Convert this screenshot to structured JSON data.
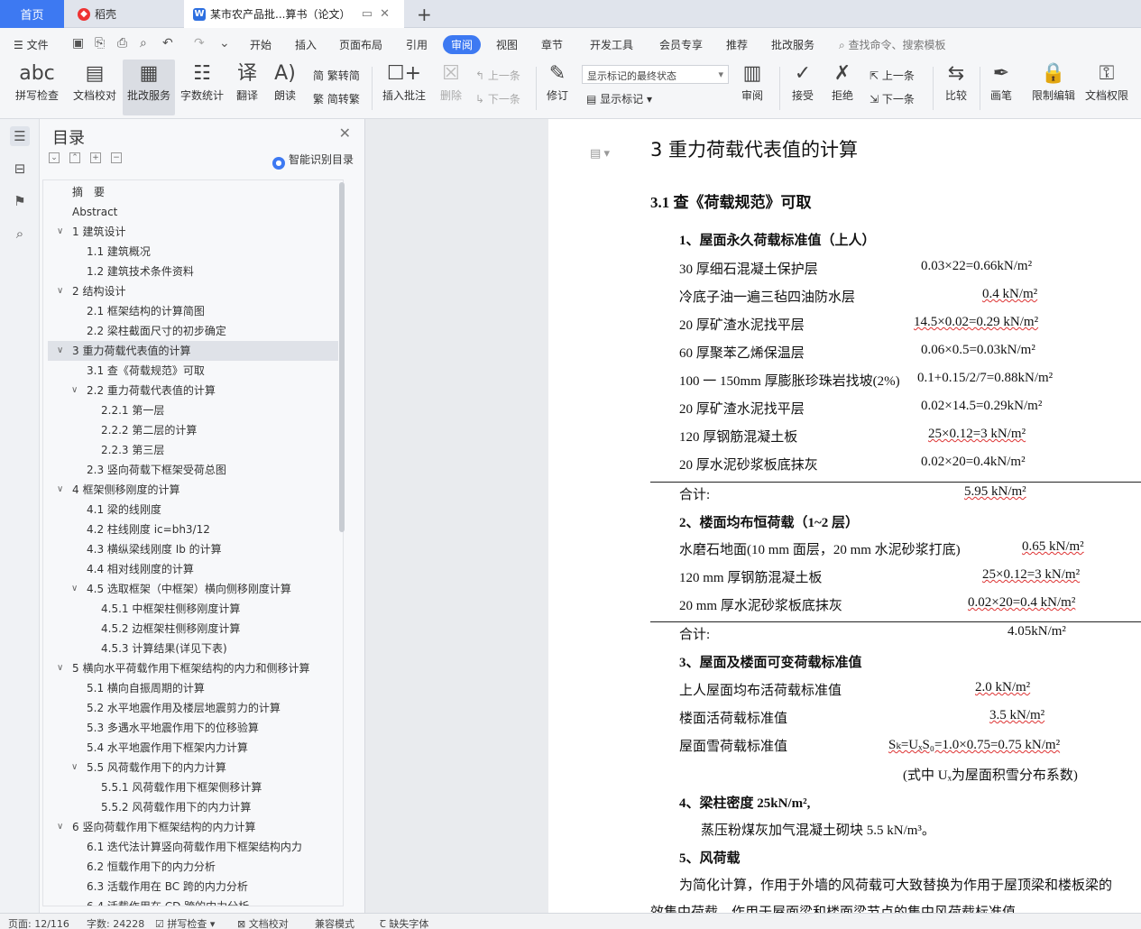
{
  "tabs": {
    "home": "首页",
    "daoke": "稻壳",
    "doc": "某市农产品批...算书（论文）"
  },
  "menu": {
    "file": "文件",
    "items": [
      "开始",
      "插入",
      "页面布局",
      "引用",
      "审阅",
      "视图",
      "章节",
      "开发工具",
      "会员专享",
      "推荐",
      "批改服务"
    ],
    "search": "查找命令、搜索模板"
  },
  "ribbon": {
    "spell": "拼写检查",
    "proof": "文档校对",
    "correct": "批改服务",
    "wordcount": "字数统计",
    "translate": "翻译",
    "read": "朗读",
    "trad": "繁转简",
    "simp": "简转繁",
    "insert_comment": "插入批注",
    "delete": "删除",
    "prev_comment": "上一条",
    "next_comment": "下一条",
    "revise": "修订",
    "markup_select": "显示标记的最终状态",
    "show_markup": "显示标记",
    "review_pane": "审阅",
    "accept": "接受",
    "reject": "拒绝",
    "prev": "上一条",
    "next": "下一条",
    "compare": "比较",
    "pen": "画笔",
    "restrict": "限制编辑",
    "permission": "文档权限"
  },
  "toc": {
    "title": "目录",
    "smart": "智能识别目录",
    "items": [
      {
        "text": "摘　要",
        "level": 0
      },
      {
        "text": "Abstract",
        "level": 0
      },
      {
        "text": "1  建筑设计",
        "level": 1
      },
      {
        "text": "1.1  建筑概况",
        "level": 2
      },
      {
        "text": "1.2  建筑技术条件资料",
        "level": 2
      },
      {
        "text": "2  结构设计",
        "level": 1
      },
      {
        "text": "2.1  框架结构的计算简图",
        "level": 2
      },
      {
        "text": "2.2  梁柱截面尺寸的初步确定",
        "level": 2
      },
      {
        "text": "3  重力荷载代表值的计算",
        "level": 1
      },
      {
        "text": "3.1  查《荷载规范》可取",
        "level": 2
      },
      {
        "text": "2.2  重力荷载代表值的计算",
        "level": 2
      },
      {
        "text": "2.2.1  第一层",
        "level": 3
      },
      {
        "text": "2.2.2  第二层的计算",
        "level": 3
      },
      {
        "text": "2.2.3  第三层",
        "level": 3
      },
      {
        "text": "2.3  竖向荷载下框架受荷总图",
        "level": 2
      },
      {
        "text": "4  框架侧移刚度的计算",
        "level": 1
      },
      {
        "text": "4.1  梁的线刚度",
        "level": 2
      },
      {
        "text": "4.2  柱线刚度 ic=bh3/12",
        "level": 2
      },
      {
        "text": "4.3  横纵梁线刚度 Ib 的计算",
        "level": 2
      },
      {
        "text": "4.4  相对线刚度的计算",
        "level": 2
      },
      {
        "text": "4.5  选取框架（中框架）横向侧移刚度计算",
        "level": 2
      },
      {
        "text": "4.5.1  中框架柱侧移刚度计算",
        "level": 3
      },
      {
        "text": "4.5.2  边框架柱侧移刚度计算",
        "level": 3
      },
      {
        "text": "4.5.3  计算结果(详见下表)",
        "level": 3
      },
      {
        "text": "5  横向水平荷载作用下框架结构的内力和侧移计算",
        "level": 1
      },
      {
        "text": "5.1  横向自振周期的计算",
        "level": 2
      },
      {
        "text": "5.2  水平地震作用及楼层地震剪力的计算",
        "level": 2
      },
      {
        "text": "5.3  多遇水平地震作用下的位移验算",
        "level": 2
      },
      {
        "text": "5.4  水平地震作用下框架内力计算",
        "level": 2
      },
      {
        "text": "5.5  风荷载作用下的内力计算",
        "level": 2
      },
      {
        "text": "5.5.1  风荷载作用下框架侧移计算",
        "level": 3
      },
      {
        "text": "5.5.2  风荷载作用下的内力计算",
        "level": 3
      },
      {
        "text": "6  竖向荷载作用下框架结构的内力计算",
        "level": 1
      },
      {
        "text": "6.1  迭代法计算竖向荷载作用下框架结构内力",
        "level": 2
      },
      {
        "text": "6.2  恒载作用下的内力分析",
        "level": 2
      },
      {
        "text": "6.3  活载作用在 BC 跨的内力分析",
        "level": 2
      },
      {
        "text": "6.4  活载作用在 CD 跨的内力分析",
        "level": 2
      }
    ]
  },
  "doc": {
    "h1": "3  重力荷载代表值的计算",
    "h2": "3.1  查《荷载规范》可取",
    "s1": "1、屋面永久荷载标准值（上人）",
    "r1": [
      [
        "30 厚细石混凝土保护层",
        "0.03×22=0.66kN/m²"
      ],
      [
        "冷底子油一遍三毡四油防水层",
        "0.4 kN/m²"
      ],
      [
        "20 厚矿渣水泥找平层",
        "14.5×0.02=0.29 kN/m²"
      ],
      [
        "60 厚聚苯乙烯保温层",
        "0.06×0.5=0.03kN/m²"
      ],
      [
        "100 一 150mm 厚膨胀珍珠岩找坡(2%)",
        "0.1+0.15/2/7=0.88kN/m²"
      ],
      [
        "20 厚矿渣水泥找平层",
        "0.02×14.5=0.29kN/m²"
      ],
      [
        "120 厚钢筋混凝土板",
        "25×0.12=3 kN/m²"
      ],
      [
        "20 厚水泥砂浆板底抹灰",
        "0.02×20=0.4kN/m²"
      ]
    ],
    "t1": [
      "合计:",
      "5.95 kN/m²"
    ],
    "s2": "2、楼面均布恒荷载（1~2 层）",
    "r2": [
      [
        "水磨石地面(10 mm 面层，20 mm 水泥砂浆打底)",
        "0.65 kN/m²"
      ],
      [
        "120 mm 厚钢筋混凝土板",
        "25×0.12=3 kN/m²"
      ],
      [
        "20 mm 厚水泥砂浆板底抹灰",
        "0.02×20=0.4 kN/m²"
      ]
    ],
    "t2": [
      "合计:",
      "4.05kN/m²"
    ],
    "s3": "3、屋面及楼面可变荷载标准值",
    "r3": [
      [
        "上人屋面均布活荷载标准值",
        "2.0 kN/m²"
      ],
      [
        "楼面活荷载标准值",
        "3.5 kN/m²"
      ],
      [
        "屋面雪荷载标准值",
        "Sₖ=UₓS₀=1.0×0.75=0.75 kN/m²"
      ]
    ],
    "note3": "(式中 Uₓ为屋面积雪分布系数)",
    "s4": "4、梁柱密度 25kN/m²,",
    "p4": "蒸压粉煤灰加气混凝土砌块 5.5 kN/m³。",
    "s5": "5、风荷载",
    "p5a": "为简化计算，作用于外墙的风荷载可大致替换为作用于屋顶梁和楼板梁的",
    "p5b": "效集中荷载，作用于屋面梁和楼面梁节点的集中风荷载标准值"
  },
  "status": {
    "page": "页面: 12/116",
    "words": "字数: 24228",
    "spell": "拼写检查",
    "proof": "文档校对",
    "compat": "兼容模式",
    "font": "缺失字体"
  }
}
